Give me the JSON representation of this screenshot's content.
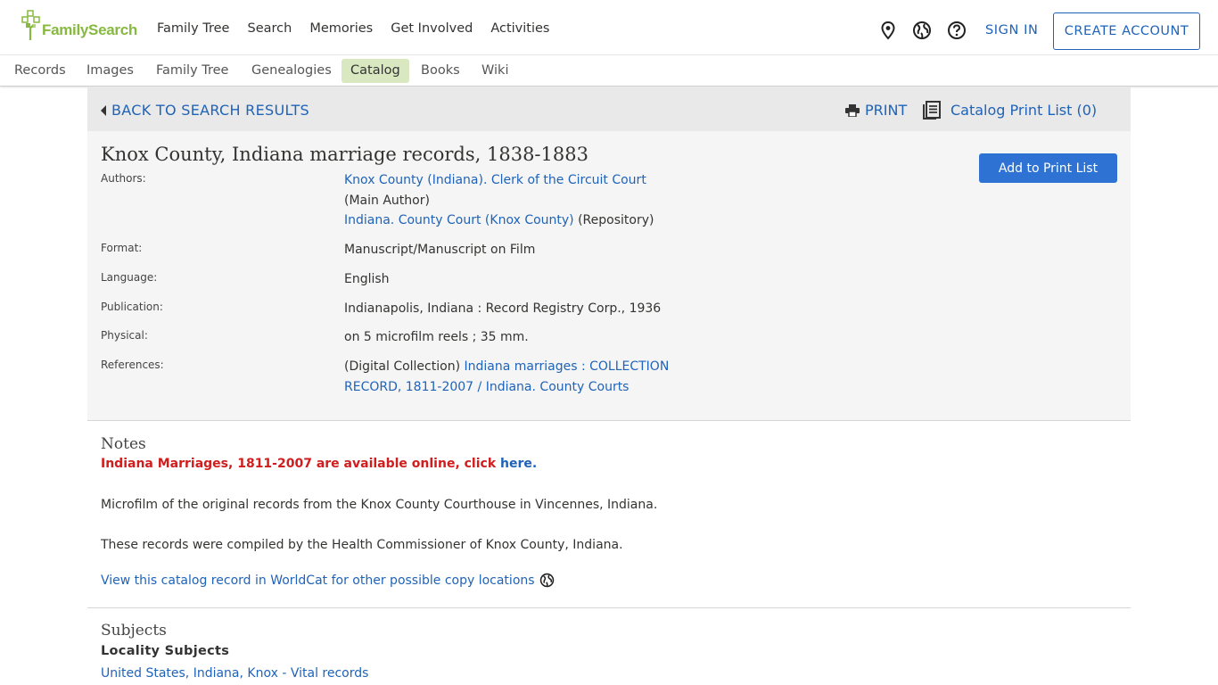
{
  "header": {
    "logo_text": "FamilySearch",
    "nav": [
      "Family Tree",
      "Search",
      "Memories",
      "Get Involved",
      "Activities"
    ],
    "sign_in": "SIGN IN",
    "create_account": "CREATE ACCOUNT",
    "icons": [
      "location-pin-icon",
      "globe-icon",
      "help-icon"
    ]
  },
  "subnav": {
    "items": [
      "Records",
      "Images",
      "Family Tree",
      "Genealogies",
      "Catalog",
      "Books",
      "Wiki"
    ],
    "active": "Catalog"
  },
  "toolbar": {
    "back": "BACK TO SEARCH RESULTS",
    "print": "PRINT",
    "print_list": "Catalog Print List (0)"
  },
  "record": {
    "title": "Knox County, Indiana marriage records, 1838-1883",
    "add_button": "Add to Print List",
    "fields": {
      "authors_label": "Authors:",
      "author1_link": "Knox County (Indiana). Clerk of the Circuit Court",
      "author1_role": "(Main Author)",
      "author2_link": "Indiana. County Court (Knox County)",
      "author2_role": " (Repository)",
      "format_label": "Format:",
      "format": "Manuscript/Manuscript on Film",
      "language_label": "Language:",
      "language": "English",
      "publication_label": "Publication:",
      "publication": "Indianapolis, Indiana : Record Registry Corp., 1936",
      "physical_label": "Physical:",
      "physical": "on 5 microfilm reels ; 35 mm.",
      "references_label": "References:",
      "references_prefix": "(Digital Collection) ",
      "references_link1": "Indiana marriages : COLLECTION",
      "references_link2": "RECORD, 1811-2007 / Indiana. County Courts"
    }
  },
  "notes": {
    "heading": "Notes",
    "notice_text": "Indiana Marriages, 1811-2007 are available online, click ",
    "notice_link": "here",
    "notice_end": ".",
    "para1": "Microfilm of the original records from the Knox County Courthouse in Vincennes, Indiana.",
    "para2": "These records were compiled by the Health Commissioner of Knox County, Indiana.",
    "worldcat": "View this catalog record in WorldCat for other possible copy locations"
  },
  "subjects": {
    "heading": "Subjects",
    "subheading": "Locality Subjects",
    "link": "United States, Indiana, Knox - Vital records"
  }
}
